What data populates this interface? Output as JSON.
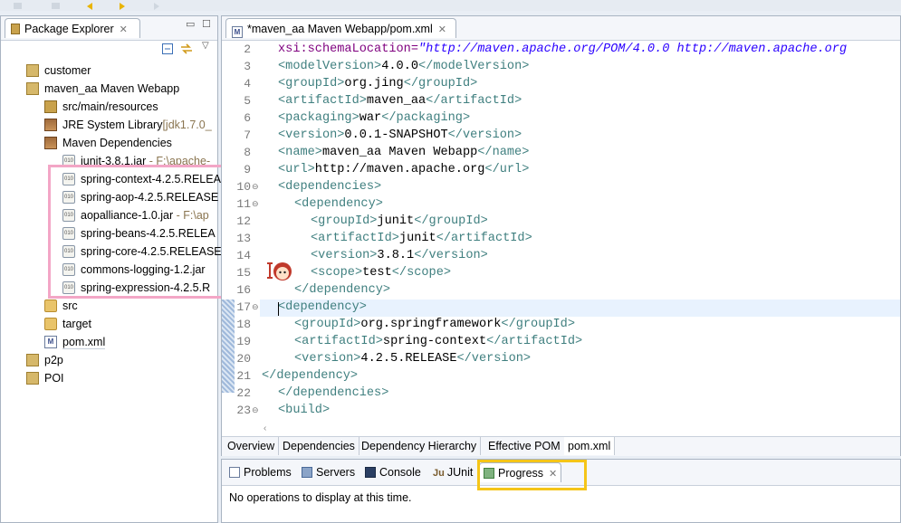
{
  "package_explorer": {
    "tab_label": "Package Explorer",
    "tree": [
      {
        "label": "customer",
        "extra": "",
        "icon": "project-icon"
      },
      {
        "label": "maven_aa Maven Webapp",
        "extra": "",
        "icon": "project-icon"
      },
      {
        "label": "src/main/resources",
        "extra": "",
        "icon": "package-folder-icon"
      },
      {
        "label": "JRE System Library",
        "extra": "[jdk1.7.0_",
        "icon": "library-icon"
      },
      {
        "label": "Maven Dependencies",
        "extra": "",
        "icon": "library-icon"
      },
      {
        "label": "junit-3.8.1.jar",
        "extra": " - F:\\apache-",
        "icon": "jar-icon"
      },
      {
        "label": "spring-context-4.2.5.RELEA",
        "extra": "",
        "icon": "jar-icon"
      },
      {
        "label": "spring-aop-4.2.5.RELEASE",
        "extra": "",
        "icon": "jar-icon"
      },
      {
        "label": "aopalliance-1.0.jar",
        "extra": " - F:\\ap",
        "icon": "jar-icon"
      },
      {
        "label": "spring-beans-4.2.5.RELEA",
        "extra": "",
        "icon": "jar-icon"
      },
      {
        "label": "spring-core-4.2.5.RELEASE",
        "extra": "",
        "icon": "jar-icon"
      },
      {
        "label": "commons-logging-1.2.jar",
        "extra": "",
        "icon": "jar-icon"
      },
      {
        "label": "spring-expression-4.2.5.R",
        "extra": "",
        "icon": "jar-icon"
      },
      {
        "label": "src",
        "extra": "",
        "icon": "folder-icon"
      },
      {
        "label": "target",
        "extra": "",
        "icon": "folder-icon"
      },
      {
        "label": "pom.xml",
        "extra": "",
        "icon": "pom-file-icon"
      },
      {
        "label": "p2p",
        "extra": "",
        "icon": "project-icon"
      },
      {
        "label": "POI",
        "extra": "",
        "icon": "project-icon"
      }
    ]
  },
  "editor": {
    "tab_label": "*maven_aa Maven Webapp/pom.xml",
    "line_numbers": [
      "2",
      "3",
      "4",
      "5",
      "6",
      "7",
      "8",
      "9",
      "10",
      "11",
      "12",
      "13",
      "14",
      "15",
      "16",
      "17",
      "18",
      "19",
      "20",
      "21",
      "22",
      "23"
    ],
    "bottom_tabs": [
      "Overview",
      "Dependencies",
      "Dependency Hierarchy",
      "Effective POM",
      "pom.xml"
    ],
    "active_bottom_tab": "pom.xml"
  },
  "bottom_panel": {
    "tabs": [
      "Problems",
      "Servers",
      "Console",
      "JUnit",
      "Progress"
    ],
    "active_tab": "Progress",
    "message": "No operations to display at this time."
  },
  "colors": {
    "tag": "#3f7f7f",
    "attr_value": "#2a00ff",
    "highlight_yellow": "#f5c518",
    "highlight_pink": "#f3a6c6"
  }
}
